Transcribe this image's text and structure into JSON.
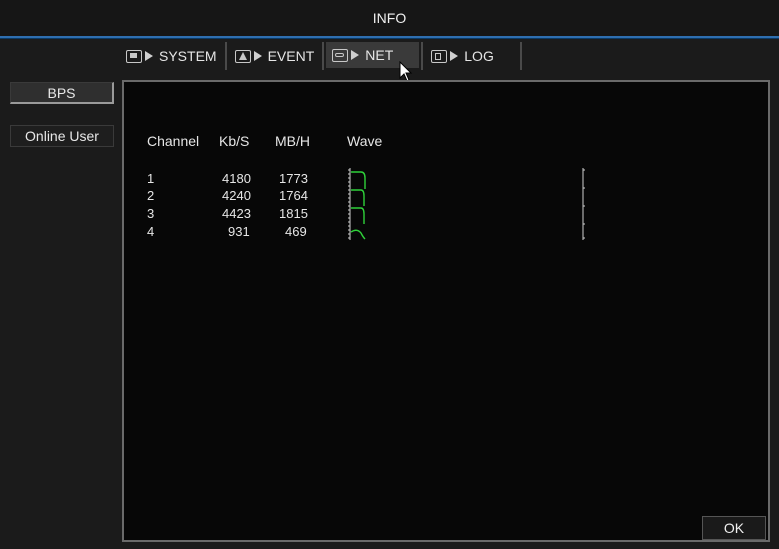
{
  "window": {
    "title": "INFO"
  },
  "tabs": [
    {
      "label": "SYSTEM",
      "icon": "system-icon"
    },
    {
      "label": "EVENT",
      "icon": "event-icon"
    },
    {
      "label": "NET",
      "icon": "net-icon",
      "active": true
    },
    {
      "label": "LOG",
      "icon": "log-icon"
    }
  ],
  "sidebar": {
    "items": [
      {
        "label": "BPS",
        "active": true
      },
      {
        "label": "Online User",
        "active": false
      }
    ]
  },
  "table": {
    "headers": [
      "Channel",
      "Kb/S",
      "MB/H",
      "Wave"
    ],
    "rows": [
      {
        "channel": "1",
        "kbs": "4180",
        "mbh": "1773"
      },
      {
        "channel": "2",
        "kbs": "4240",
        "mbh": "1764"
      },
      {
        "channel": "3",
        "kbs": "4423",
        "mbh": "1815"
      },
      {
        "channel": "4",
        "kbs": "931",
        "mbh": "469"
      }
    ]
  },
  "footer": {
    "ok_label": "OK"
  },
  "colors": {
    "accent": "#2f6fb0",
    "wave": "#2fd13a",
    "panel_bg": "#070707"
  }
}
